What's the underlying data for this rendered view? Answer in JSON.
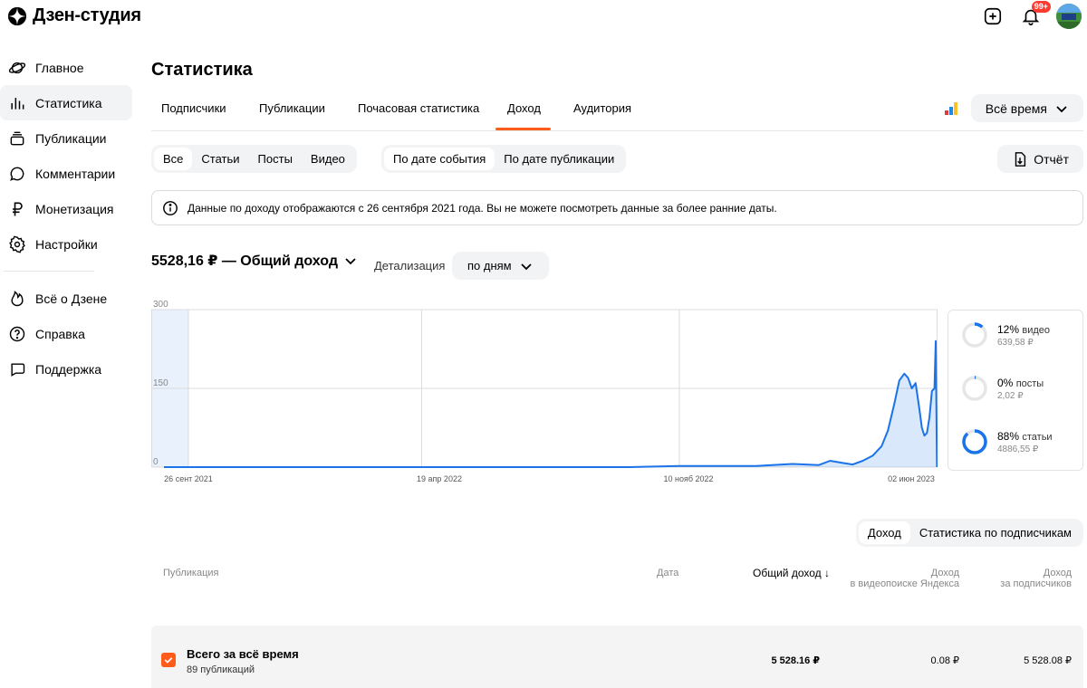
{
  "app": {
    "title": "Дзен-студия",
    "notif_badge": "99+"
  },
  "sidebar": {
    "items": [
      {
        "label": "Главное",
        "icon": "planet-icon"
      },
      {
        "label": "Статистика",
        "icon": "bar-chart-icon",
        "active": true
      },
      {
        "label": "Публикации",
        "icon": "stack-icon"
      },
      {
        "label": "Комментарии",
        "icon": "comment-icon"
      },
      {
        "label": "Монетизация",
        "icon": "ruble-icon"
      },
      {
        "label": "Настройки",
        "icon": "gear-icon"
      }
    ],
    "items2": [
      {
        "label": "Всё о Дзене",
        "icon": "flame-icon"
      },
      {
        "label": "Справка",
        "icon": "question-icon"
      },
      {
        "label": "Поддержка",
        "icon": "chat-icon"
      }
    ]
  },
  "page": {
    "title": "Статистика"
  },
  "tabs": [
    "Подписчики",
    "Публикации",
    "Почасовая статистика",
    "Доход",
    "Аудитория"
  ],
  "period": {
    "label": "Всё время"
  },
  "filters": {
    "type": [
      "Все",
      "Статьи",
      "Посты",
      "Видео"
    ],
    "date": [
      "По дате события",
      "По дате публикации"
    ]
  },
  "report": {
    "label": "Отчёт"
  },
  "info": {
    "text": "Данные по доходу отображаются с 26 сентября 2021 года. Вы не можете посмотреть данные за более ранние даты."
  },
  "summary": {
    "value": "5528,16 ₽ — Общий доход",
    "detail_label": "Детализация",
    "detail_value": "по дням"
  },
  "chart_data": {
    "type": "area",
    "yticks": [
      "300",
      "150",
      "0"
    ],
    "ylim": [
      0,
      300
    ],
    "xticks": [
      "26 сент 2021",
      "19 апр 2022",
      "10 нояб 2022",
      "02 июн 2023"
    ],
    "color": "#1a73e8",
    "x": [
      "2021-09-26",
      "2022-10-01",
      "2022-11-10",
      "2023-01-10",
      "2023-02-08",
      "2023-03-01",
      "2023-03-10",
      "2023-03-20",
      "2023-03-28",
      "2023-04-05",
      "2023-04-13",
      "2023-04-20",
      "2023-04-25",
      "2023-04-30",
      "2023-05-04",
      "2023-05-08",
      "2023-05-11",
      "2023-05-14",
      "2023-05-17",
      "2023-05-20",
      "2023-05-22",
      "2023-05-24",
      "2023-05-26",
      "2023-05-28",
      "2023-05-30",
      "2023-06-01",
      "2023-06-02",
      "2023-06-03"
    ],
    "values": [
      0,
      0,
      2,
      2,
      6,
      4,
      12,
      8,
      5,
      12,
      22,
      40,
      70,
      120,
      165,
      178,
      170,
      150,
      160,
      110,
      75,
      60,
      65,
      95,
      145,
      150,
      240,
      0
    ]
  },
  "donuts": [
    {
      "pct": "12%",
      "label": "видео",
      "amount": "639,58 ₽",
      "fraction": 0.12
    },
    {
      "pct": "0%",
      "label": "посты",
      "amount": "2,02 ₽",
      "fraction": 0.004
    },
    {
      "pct": "88%",
      "label": "статьи",
      "amount": "4886,55 ₽",
      "fraction": 0.88
    }
  ],
  "table_tabs": [
    "Доход",
    "Статистика по подписчикам"
  ],
  "table": {
    "headers": {
      "publication": "Публикация",
      "date": "Дата",
      "total": "Общий доход",
      "video_search_1": "Доход",
      "video_search_2": "в видеопоиске Яндекса",
      "subs_1": "Доход",
      "subs_2": "за подписчиков"
    },
    "total_row": {
      "title": "Всего за всё время",
      "subtitle": "89 публикаций",
      "total": "5 528.16 ₽",
      "video_search": "0.08 ₽",
      "subs": "5 528.08 ₽"
    }
  }
}
